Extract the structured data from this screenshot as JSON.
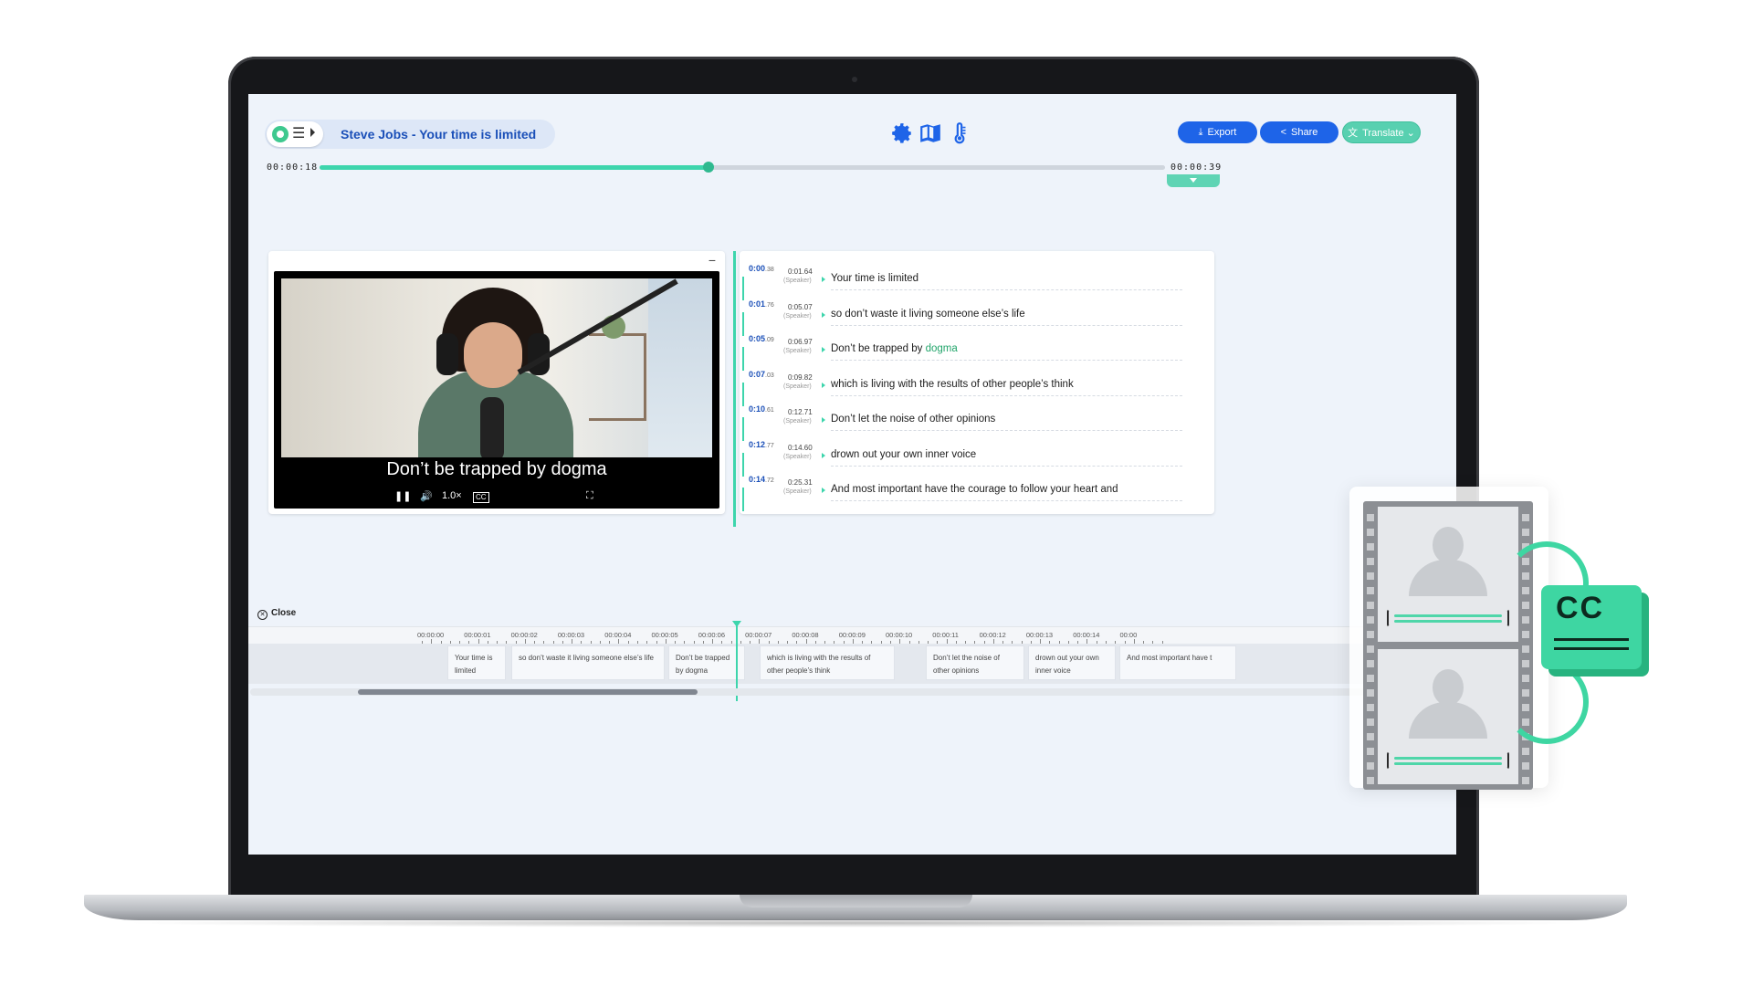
{
  "header": {
    "title": "Steve Jobs - Your time is limited",
    "menu_glyph": "☰",
    "export_label": "Export",
    "share_label": "Share",
    "translate_label": "Translate",
    "icons": [
      "settings-gear-icon",
      "book-icon",
      "thermometer-icon"
    ]
  },
  "progress": {
    "current_time": "00:00:18",
    "total_time": "00:00:39",
    "fraction": 0.46
  },
  "player": {
    "minimize_glyph": "−",
    "subtitle": "Don’t be trapped by dogma",
    "speed": "1.0×",
    "pause_glyph": "❚❚",
    "volume_glyph": "🔊",
    "cc_glyph": "CC",
    "fullscreen_glyph": "⛶"
  },
  "transcript": [
    {
      "start": "0:00",
      "start_ms": ".38",
      "end": "0:01.64",
      "speaker": "(Speaker)",
      "text": "Your time is limited",
      "highlight": ""
    },
    {
      "start": "0:01",
      "start_ms": ".76",
      "end": "0:05.07",
      "speaker": "(Speaker)",
      "text": "so don’t waste it living someone else’s life",
      "highlight": ""
    },
    {
      "start": "0:05",
      "start_ms": ".09",
      "end": "0:06.97",
      "speaker": "(Speaker)",
      "text": "Don’t be trapped by ",
      "highlight": "dogma"
    },
    {
      "start": "0:07",
      "start_ms": ".03",
      "end": "0:09.82",
      "speaker": "(Speaker)",
      "text": "which is living with the results of other people’s think",
      "highlight": ""
    },
    {
      "start": "0:10",
      "start_ms": ".61",
      "end": "0:12.71",
      "speaker": "(Speaker)",
      "text": "Don’t let the noise of other opinions",
      "highlight": ""
    },
    {
      "start": "0:12",
      "start_ms": ".77",
      "end": "0:14.60",
      "speaker": "(Speaker)",
      "text": "drown out your own inner voice",
      "highlight": ""
    },
    {
      "start": "0:14",
      "start_ms": ".72",
      "end": "0:25.31",
      "speaker": "(Speaker)",
      "text": "And most important have the courage to follow your heart and",
      "highlight": ""
    }
  ],
  "close_label": "Close",
  "timeline": {
    "ticks": [
      "00:00:00",
      "00:00:01",
      "00:00:02",
      "00:00:03",
      "00:00:04",
      "00:00:05",
      "00:00:06",
      "00:00:07",
      "00:00:08",
      "00:00:09",
      "00:00:10",
      "00:00:11",
      "00:00:12",
      "00:00:13",
      "00:00:14",
      "00:00"
    ],
    "clips": [
      "Your time is limited",
      "so don’t waste it living someone else’s life",
      "Don’t be trapped by dogma",
      "which is living with the results of other people’s think",
      "Don’t let the noise of other opinions",
      "drown out your own inner voice",
      "And most important have t"
    ]
  },
  "colors": {
    "accent_teal": "#3dd5ac",
    "primary_blue": "#1e64e8",
    "title_blue": "#1a4fb8",
    "highlight_green": "#22a56b"
  }
}
